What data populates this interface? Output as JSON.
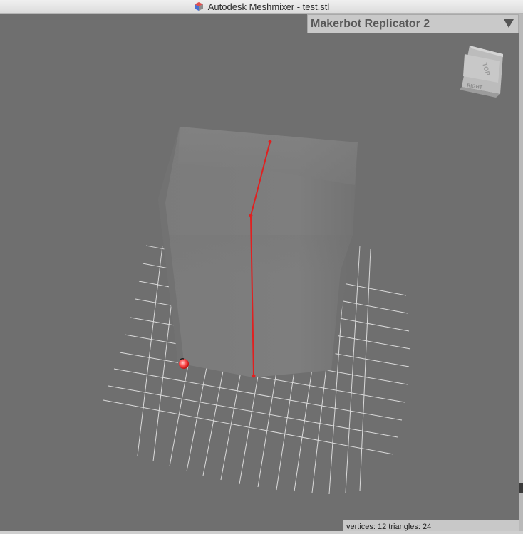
{
  "window": {
    "title": "Autodesk Meshmixer - test.stl"
  },
  "printer": {
    "selected": "Makerbot Replicator 2"
  },
  "view_cube": {
    "top_label": "TOP",
    "right_label": "RIGHT"
  },
  "status": {
    "text": "vertices: 12 triangles: 24"
  },
  "colors": {
    "viewport_bg": "#6f6f6f",
    "mesh": "#7a7a7a",
    "grid": "#e8e8e8",
    "measure_line": "#e02020",
    "pivot": "#ff5050"
  },
  "icons": {
    "app": "meshmixer-cube-icon",
    "dropdown": "triangle-down-icon"
  }
}
